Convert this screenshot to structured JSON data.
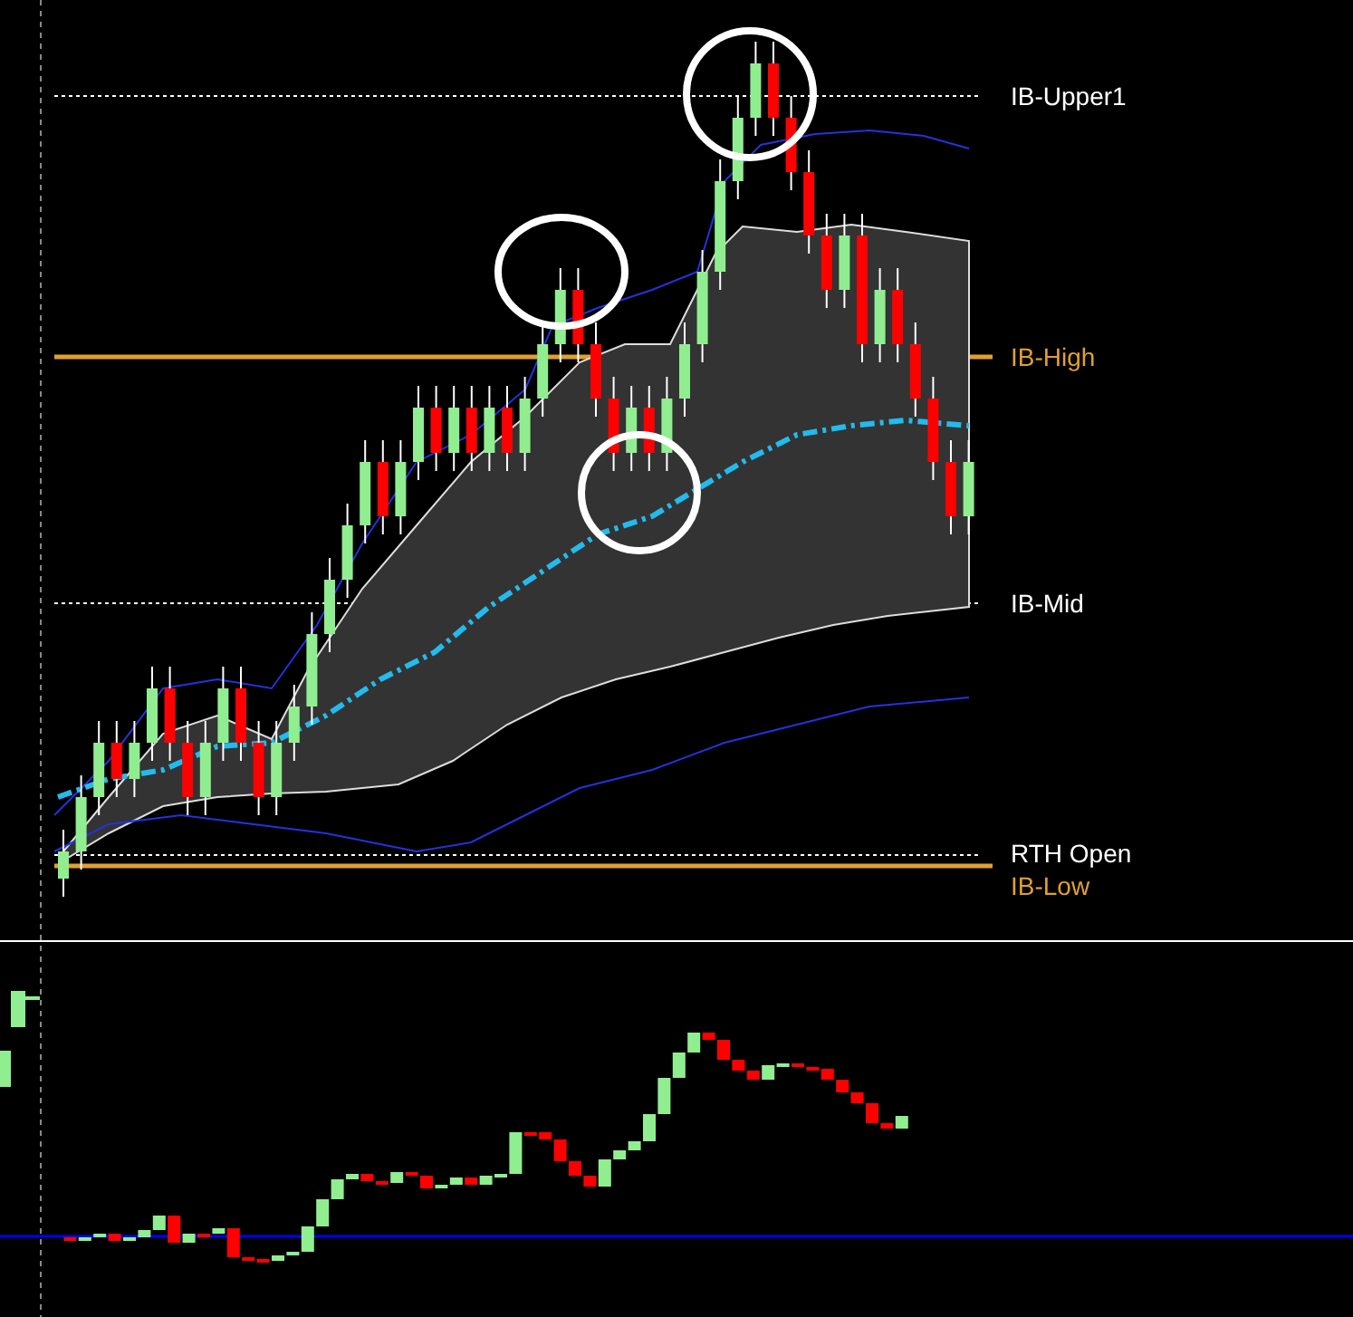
{
  "price_panel": {
    "levels": [
      {
        "label": "IB-Upper1",
        "kind": "dotted",
        "color": "#ffffff"
      },
      {
        "label": "IB-High",
        "kind": "solid",
        "color": "#e0a030"
      },
      {
        "label": "IB-Mid",
        "kind": "dotted",
        "color": "#ffffff"
      },
      {
        "label": "RTH Open",
        "kind": "dotted",
        "color": "#ffffff"
      },
      {
        "label": "IB-Low",
        "kind": "solid",
        "color": "#e0a030"
      }
    ]
  }
}
